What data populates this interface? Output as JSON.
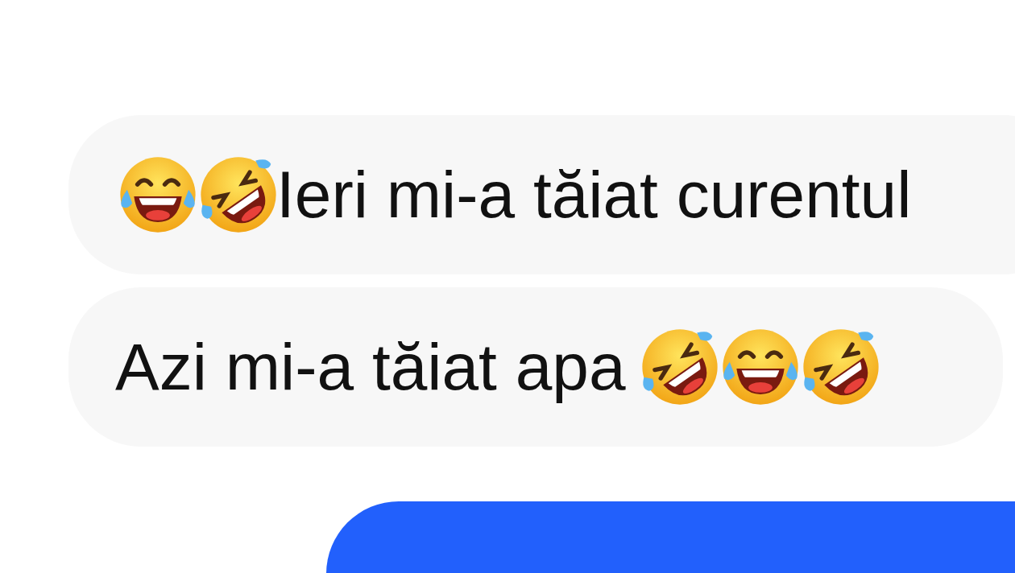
{
  "messages": [
    {
      "kind": "incoming",
      "leading_icons": [
        {
          "kind": "tears-of-joy"
        },
        {
          "kind": "rolling-laughing"
        }
      ],
      "text": "Ieri mi-a tăiat curentul"
    },
    {
      "kind": "incoming",
      "text": "Azi mi-a tăiat apa",
      "trailing_icons": [
        {
          "kind": "rolling-laughing"
        },
        {
          "kind": "tears-of-joy"
        },
        {
          "kind": "rolling-laughing"
        }
      ]
    },
    {
      "kind": "outgoing"
    }
  ]
}
